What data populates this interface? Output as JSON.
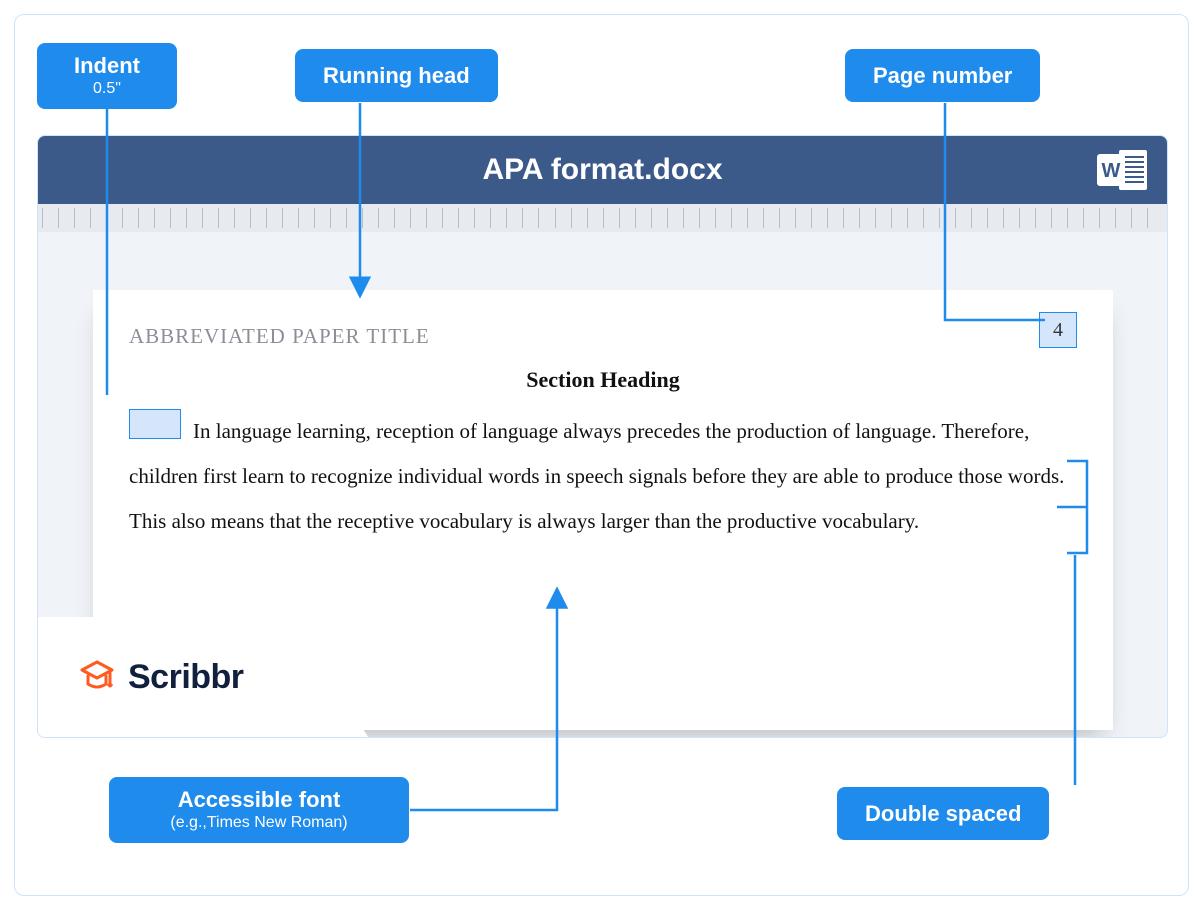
{
  "callouts": {
    "indent": {
      "label": "Indent",
      "sub": "0.5\""
    },
    "running_head": {
      "label": "Running head"
    },
    "page_number": {
      "label": "Page number"
    },
    "accessible_font": {
      "label": "Accessible font",
      "sub": "(e.g.,Times New Roman)"
    },
    "double_spaced": {
      "label": "Double spaced"
    }
  },
  "document": {
    "titlebar": "APA format.docx",
    "running_head_text": "ABBREVIATED PAPER TITLE",
    "page_number": "4",
    "section_heading": "Section Heading",
    "body_paragraph": "In language learning, reception of language always precedes the production of language. Therefore, children first learn to recognize individual words in speech signals before they are able to produce those words. This also means that the receptive vocabulary is always larger than the productive vocabulary."
  },
  "brand": "Scribbr"
}
